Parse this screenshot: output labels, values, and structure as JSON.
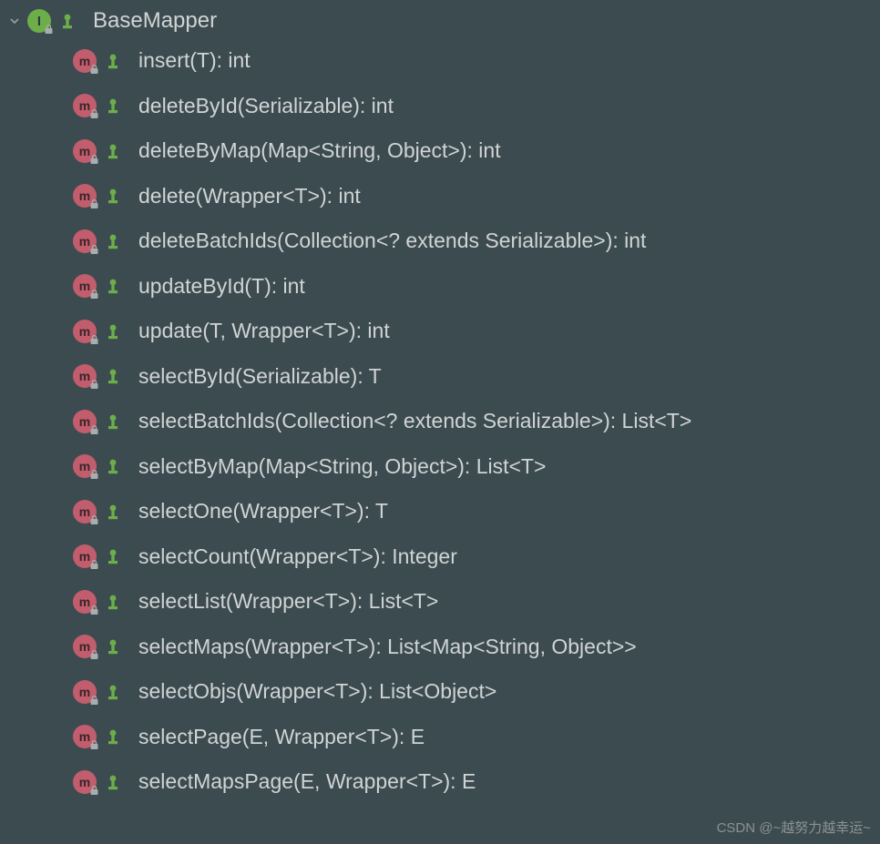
{
  "root": {
    "name": "BaseMapper"
  },
  "methods": [
    {
      "signature": "insert(T): int"
    },
    {
      "signature": "deleteById(Serializable): int"
    },
    {
      "signature": "deleteByMap(Map<String, Object>): int"
    },
    {
      "signature": "delete(Wrapper<T>): int"
    },
    {
      "signature": "deleteBatchIds(Collection<? extends Serializable>): int"
    },
    {
      "signature": "updateById(T): int"
    },
    {
      "signature": "update(T, Wrapper<T>): int"
    },
    {
      "signature": "selectById(Serializable): T"
    },
    {
      "signature": "selectBatchIds(Collection<? extends Serializable>): List<T>"
    },
    {
      "signature": "selectByMap(Map<String, Object>): List<T>"
    },
    {
      "signature": "selectOne(Wrapper<T>): T"
    },
    {
      "signature": "selectCount(Wrapper<T>): Integer"
    },
    {
      "signature": "selectList(Wrapper<T>): List<T>"
    },
    {
      "signature": "selectMaps(Wrapper<T>): List<Map<String, Object>>"
    },
    {
      "signature": "selectObjs(Wrapper<T>): List<Object>"
    },
    {
      "signature": "selectPage(E, Wrapper<T>): E"
    },
    {
      "signature": "selectMapsPage(E, Wrapper<T>): E"
    }
  ],
  "watermark": "CSDN @~越努力越幸运~"
}
